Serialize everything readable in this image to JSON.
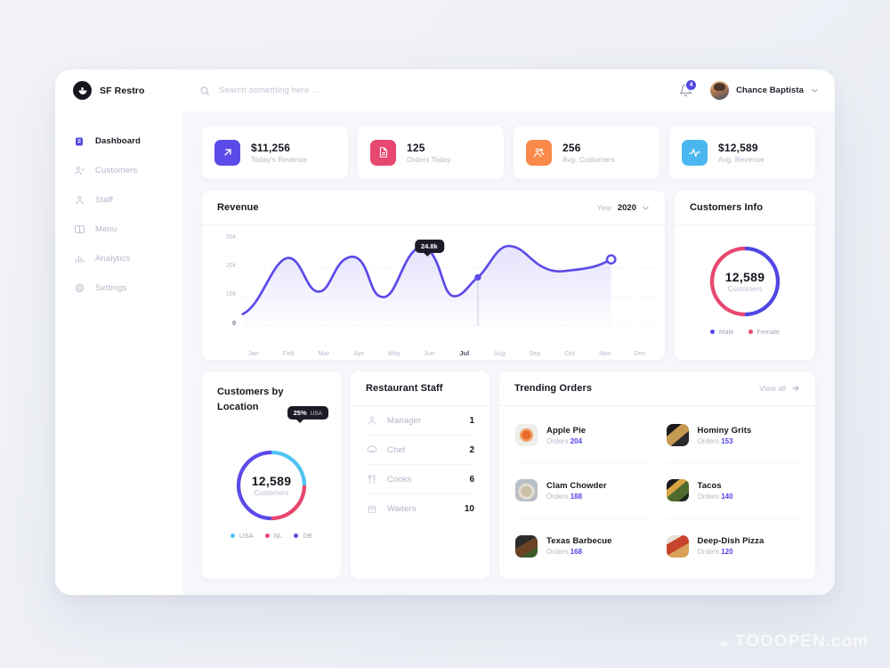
{
  "brand": {
    "name": "SF Restro",
    "logo_icon": "bowl-logo-icon"
  },
  "search": {
    "placeholder": "Search something here ...",
    "value": "",
    "icon": "search-icon"
  },
  "header": {
    "notifications_count": "4",
    "bell_icon": "bell-icon",
    "user_name": "Chance Baptista",
    "caret_icon": "chevron-down-icon",
    "avatar_icon": "user-avatar"
  },
  "sidebar": {
    "items": [
      {
        "label": "Dashboard",
        "icon": "dashboard-icon",
        "active": true
      },
      {
        "label": "Customers",
        "icon": "customers-icon",
        "active": false
      },
      {
        "label": "Staff",
        "icon": "staff-icon",
        "active": false
      },
      {
        "label": "Menu",
        "icon": "menu-book-icon",
        "active": false
      },
      {
        "label": "Analytics",
        "icon": "analytics-bars-icon",
        "active": false
      },
      {
        "label": "Settings",
        "icon": "gear-icon",
        "active": false
      }
    ]
  },
  "stats": [
    {
      "value": "$11,256",
      "label": "Today's Revenue",
      "icon": "arrow-up-right-icon",
      "color": "#5b4ae8"
    },
    {
      "value": "125",
      "label": "Orders Today",
      "icon": "document-icon",
      "color": "#e8476f"
    },
    {
      "value": "256",
      "label": "Avg. Customers",
      "icon": "people-icon",
      "color": "#f98a4b"
    },
    {
      "value": "$12,589",
      "label": "Avg. Revenue",
      "icon": "pulse-icon",
      "color": "#4ab8ef"
    }
  ],
  "revenue": {
    "title": "Revenue",
    "year_label": "Year",
    "year_value": "2020",
    "caret_icon": "chevron-down-icon",
    "tooltip": "24.8k",
    "tooltip_month": "Jul"
  },
  "customers_info": {
    "title": "Customers Info",
    "total": "12,589",
    "sublabel": "Customers",
    "legend": [
      {
        "label": "Male",
        "color": "#4f46e5",
        "percent": 50
      },
      {
        "label": "Female",
        "color": "#e8476f",
        "percent": 50
      }
    ]
  },
  "customers_location": {
    "title": "Customers  by Location",
    "total": "12,589",
    "sublabel": "Customers",
    "tooltip_percent": "25%",
    "tooltip_label": "USA",
    "legend": [
      {
        "label": "USA",
        "color": "#4ec3f0",
        "percent": 25
      },
      {
        "label": "NL",
        "color": "#e8476f",
        "percent": 25
      },
      {
        "label": "DE",
        "color": "#5b4ae8",
        "percent": 50
      }
    ]
  },
  "restaurant_staff": {
    "title": "Restaurant Staff",
    "rows": [
      {
        "role": "Manager",
        "count": "1",
        "icon": "person-icon"
      },
      {
        "role": "Chef",
        "count": "2",
        "icon": "chef-hat-icon"
      },
      {
        "role": "Cooks",
        "count": "6",
        "icon": "fork-spoon-icon"
      },
      {
        "role": "Waiters",
        "count": "10",
        "icon": "tray-icon"
      }
    ]
  },
  "trending_orders": {
    "title": "Trending Orders",
    "view_all": "View all",
    "view_all_icon": "arrow-right-icon",
    "orders_word": "Orders",
    "items": [
      {
        "name": "Apple Pie",
        "orders": "204",
        "thumb": "t-applepie"
      },
      {
        "name": "Hominy Grits",
        "orders": "153",
        "thumb": "t-hominy"
      },
      {
        "name": "Clam Chowder",
        "orders": "188",
        "thumb": "t-clam"
      },
      {
        "name": "Tacos",
        "orders": "140",
        "thumb": "t-tacos"
      },
      {
        "name": "Texas Barbecue",
        "orders": "168",
        "thumb": "t-texas"
      },
      {
        "name": "Deep-Dish Pizza",
        "orders": "120",
        "thumb": "t-pizza"
      }
    ]
  },
  "watermark": {
    "text": "TOOOPEN.com"
  },
  "chart_data": {
    "type": "line",
    "title": "Revenue",
    "xlabel": "",
    "ylabel": "",
    "categories": [
      "Jan",
      "Feb",
      "Mar",
      "Apr",
      "May",
      "Jun",
      "Jul",
      "Aug",
      "Sep",
      "Oct",
      "Nov",
      "Dec"
    ],
    "ytick_labels": [
      "0",
      "10k",
      "20k",
      "30k"
    ],
    "ytick_values": [
      0,
      10000,
      20000,
      30000
    ],
    "ylim": [
      0,
      30000
    ],
    "grid": true,
    "legend": "none",
    "highlight": {
      "month": "Jul",
      "value": "24.8k",
      "value_num": 24800
    },
    "end_marker": {
      "month": "Oct",
      "value_num": 22500
    },
    "series": [
      {
        "name": "Revenue",
        "color": "#5b4ae8",
        "values": [
          5000,
          19500,
          12800,
          19400,
          11000,
          22800,
          11000,
          24800,
          25200,
          20200,
          null,
          null
        ]
      }
    ]
  }
}
